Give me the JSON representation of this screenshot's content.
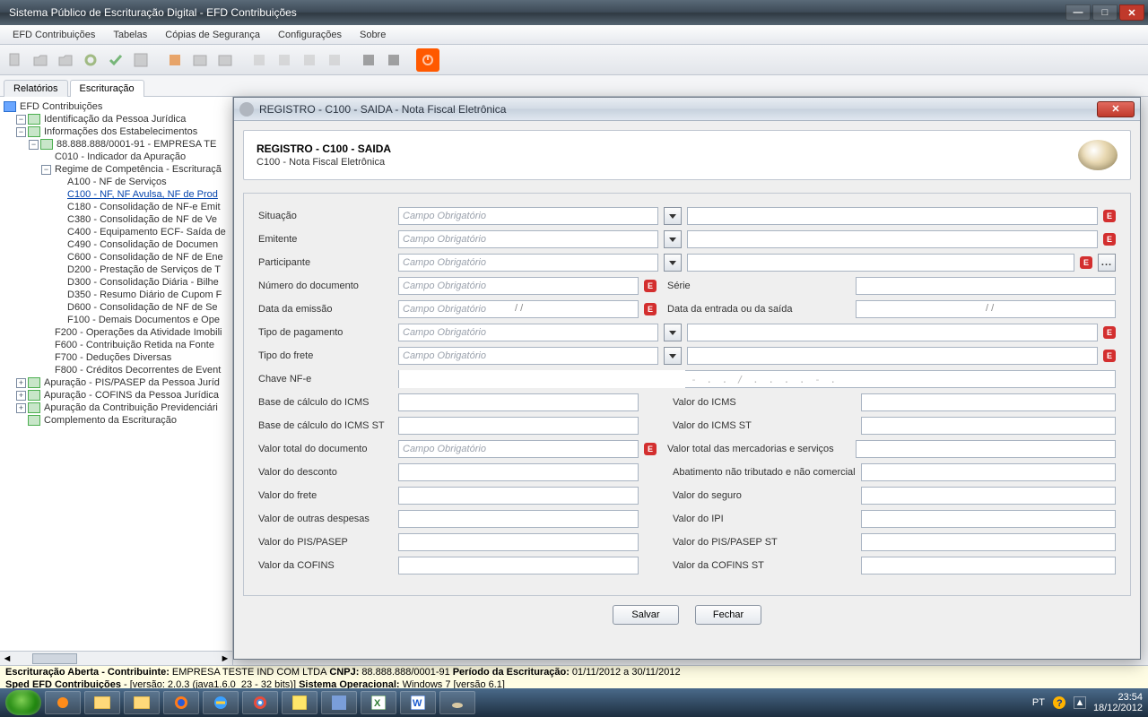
{
  "window": {
    "title": "Sistema Público de Escrituração Digital - EFD Contribuições"
  },
  "menu": {
    "items": [
      "EFD Contribuições",
      "Tabelas",
      "Cópias de Segurança",
      "Configurações",
      "Sobre"
    ]
  },
  "tabs": {
    "relatorios": "Relatórios",
    "escrituracao": "Escrituração"
  },
  "tree": {
    "root": "EFD Contribuições",
    "n1": "Identificação da Pessoa Jurídica",
    "n2": "Informações dos Estabelecimentos",
    "n3": "88.888.888/0001-91  -  EMPRESA TE",
    "n4": "C010 - Indicador da Apuração",
    "n5": "Regime de Competência - Escrituraçã",
    "n6": "A100 - NF de Serviços",
    "n7": "C100 - NF, NF Avulsa, NF de Prod",
    "n8": "C180 - Consolidação de NF-e Emit",
    "n9": "C380 - Consolidação de NF de Ve",
    "n10": "C400 - Equipamento ECF- Saída de",
    "n11": "C490 - Consolidação de Documen",
    "n12": "C600 - Consolidação de NF de Ene",
    "n13": "D200 - Prestação de Serviços de T",
    "n14": "D300 - Consolidação Diária - Bilhe",
    "n15": "D350 - Resumo Diário de Cupom F",
    "n16": "D600 - Consolidação de NF de Se",
    "n17": "F100 - Demais Documentos e Ope",
    "n18": "F200 - Operações da Atividade Imobili",
    "n19": "F600 - Contribuição Retida na Fonte",
    "n20": "F700 - Deduções Diversas",
    "n21": "F800 - Créditos Decorrentes de Event",
    "n22": "Apuração - PIS/PASEP da Pessoa Juríd",
    "n23": "Apuração - COFINS da Pessoa Jurídica",
    "n24": "Apuração da Contribuição Previdenciári",
    "n25": "Complemento da Escrituração"
  },
  "dialog": {
    "title": "REGISTRO - C100 - SAIDA - Nota Fiscal Eletrônica",
    "heading": "REGISTRO - C100 - SAIDA",
    "subheading": "C100 - Nota Fiscal Eletrônica",
    "placeholder": "Campo Obrigatório",
    "date_mask": "/ /",
    "chave_mask": "- . . / . . . . - .",
    "labels": {
      "situacao": "Situação",
      "emitente": "Emitente",
      "participante": "Participante",
      "numero": "Número do documento",
      "serie": "Série",
      "data_emissao": "Data da emissão",
      "data_entrada": "Data da entrada ou da saída",
      "tipo_pagamento": "Tipo de pagamento",
      "tipo_frete": "Tipo do frete",
      "chave": "Chave NF-e",
      "base_icms": "Base de cálculo do ICMS",
      "valor_icms": "Valor do ICMS",
      "base_icms_st": "Base de cálculo do ICMS ST",
      "valor_icms_st": "Valor do ICMS ST",
      "valor_total_doc": "Valor total do documento",
      "valor_total_merc": "Valor total das mercadorias e serviços",
      "valor_desconto": "Valor do desconto",
      "abatimento": "Abatimento não tributado e não comercial",
      "valor_frete": "Valor do frete",
      "valor_seguro": "Valor do seguro",
      "valor_outras": "Valor de outras despesas",
      "valor_ipi": "Valor do IPI",
      "valor_pis": "Valor do PIS/PASEP",
      "valor_pis_st": "Valor do PIS/PASEP ST",
      "valor_cofins": "Valor da COFINS",
      "valor_cofins_st": "Valor da COFINS ST"
    },
    "buttons": {
      "salvar": "Salvar",
      "fechar": "Fechar"
    },
    "more": "..."
  },
  "status": {
    "line1_a": "Escrituração Aberta - Contribuinte:",
    "line1_b": "EMPRESA TESTE IND COM LTDA",
    "line1_c": "CNPJ:",
    "line1_d": "88.888.888/0001-91",
    "line1_e": "Período da Escrituração:",
    "line1_f": "01/11/2012 a 30/11/2012",
    "line2_a": "Sped EFD Contribuições",
    "line2_b": " - [versão: 2.0.3 (java1.6.0_23 - 32 bits)] ",
    "line2_c": "Sistema Operacional:",
    "line2_d": " Windows 7 [versão 6.1]"
  },
  "taskbar": {
    "lang": "PT",
    "time": "23:54",
    "date": "18/12/2012"
  }
}
